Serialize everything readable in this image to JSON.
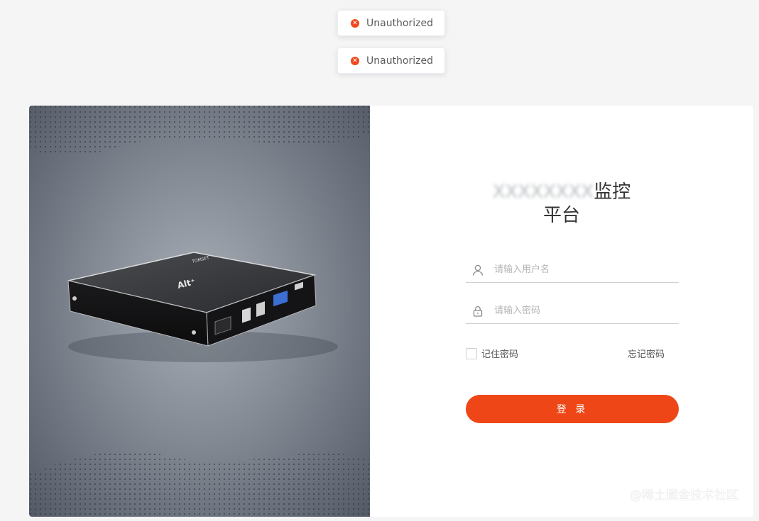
{
  "toasts": [
    {
      "message": "Unauthorized",
      "icon": "close-circle-icon",
      "color": "#f0461e"
    },
    {
      "message": "Unauthorized",
      "icon": "close-circle-icon",
      "color": "#f0461e"
    }
  ],
  "login": {
    "title_hidden": "XXXXXXXX",
    "title_visible_line1": "监控",
    "title_visible_line2": "平台",
    "username_placeholder": "请输入用户名",
    "password_placeholder": "请输入密码",
    "remember_label": "记住密码",
    "forgot_label": "忘记密码",
    "submit_label": "登 录",
    "accent_color": "#ee4616"
  },
  "hero": {
    "device_brand_text": "TOMSET",
    "device_logo_text": "Alt⁺"
  },
  "watermark": "@稀土掘金技术社区"
}
